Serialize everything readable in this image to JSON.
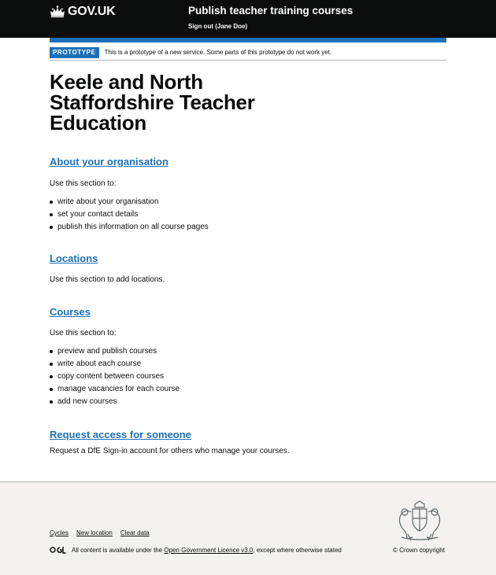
{
  "header": {
    "logo_text": "GOV.UK",
    "service_name": "Publish teacher training courses",
    "sign_out": "Sign out (Jane Doe)"
  },
  "phase_banner": {
    "tag": "PROTOTYPE",
    "text": "This is a prototype of a new service. Some parts of this prototype do not work yet."
  },
  "main": {
    "title": "Keele and North Staffordshire Teacher Education",
    "sections": [
      {
        "heading": "About your organisation",
        "intro": "Use this section to:",
        "items": [
          "write about your organisation",
          "set your contact details",
          "publish this information on all course pages"
        ]
      },
      {
        "heading": "Locations",
        "intro": "Use this section to add locations."
      },
      {
        "heading": "Courses",
        "intro": "Use this section to:",
        "items": [
          "preview and publish courses",
          "write about each course",
          "copy content between courses",
          "manage vacancies for each course",
          "add new courses"
        ]
      },
      {
        "heading": "Request access for someone",
        "intro": "Request a DfE Sign-in account for others who manage your courses."
      }
    ]
  },
  "footer": {
    "links": [
      "Cycles",
      "New location",
      "Clear data"
    ],
    "licence_prefix": "All content is available under the",
    "licence_link": "Open Government Licence v3.0",
    "licence_suffix": ", except where otherwise stated",
    "copyright": "© Crown copyright"
  },
  "colors": {
    "header_bg": "#0b0c0c",
    "brand_blue": "#1d70b8",
    "footer_bg": "#f3f2f1"
  }
}
